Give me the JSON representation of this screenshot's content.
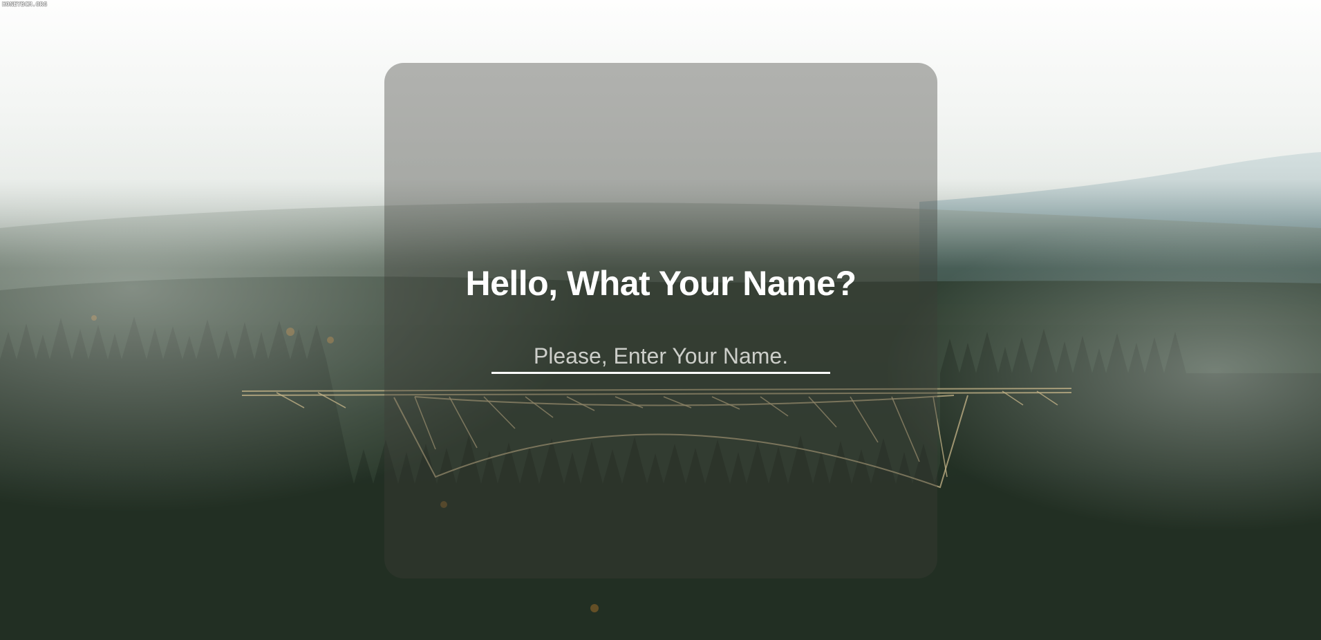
{
  "watermark": "HONEYBCM.ORG",
  "form": {
    "title": "Hello, What Your Name?",
    "input_value": "",
    "input_placeholder": "Please, Enter Your Name."
  },
  "colors": {
    "sky": "#f2f3f0",
    "forest": "#2b3a2c",
    "card_overlay": "rgba(60,60,55,0.38)",
    "text": "#ffffff"
  }
}
